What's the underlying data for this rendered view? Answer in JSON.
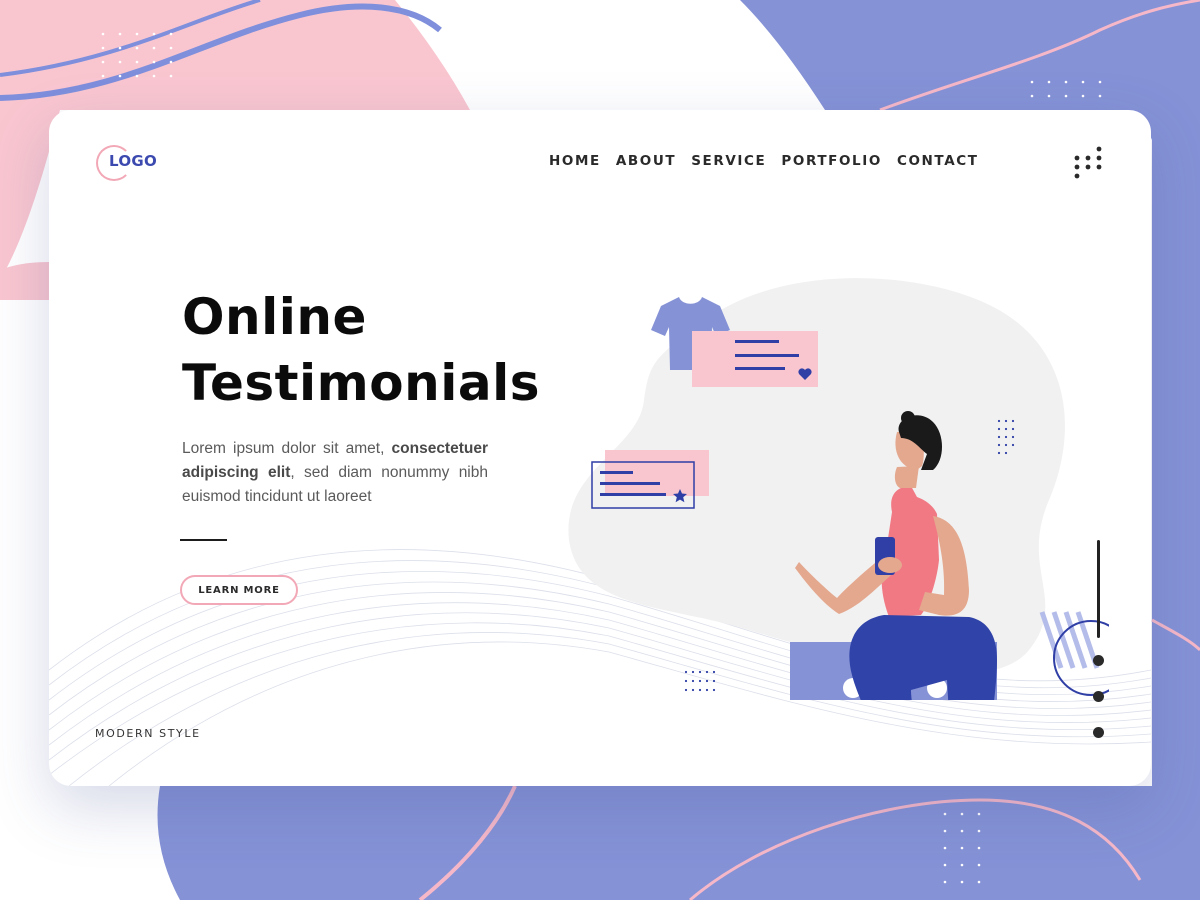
{
  "logo": {
    "text": "LOGO"
  },
  "nav": {
    "items": [
      {
        "label": "HOME"
      },
      {
        "label": "ABOUT"
      },
      {
        "label": "SERVICE"
      },
      {
        "label": "PORTFOLIO"
      },
      {
        "label": "CONTACT"
      }
    ]
  },
  "menu_icon": "grid-dots-icon",
  "hero": {
    "title_line1": "Online",
    "title_line2": "Testimonials",
    "text_part1": "Lorem ipsum dolor sit amet, ",
    "text_bold": "consectetuer adipiscing elit",
    "text_part2": ", sed diam nonummy nibh euismod tincidunt ut laoreet",
    "button_label": "LEARN MORE"
  },
  "footer": {
    "label": "MODERN STYLE"
  },
  "pager": {
    "dots": 3
  },
  "colors": {
    "pink": "#f9c6d0",
    "pink_accent": "#f2a8b6",
    "periwinkle": "#8592d6",
    "navy": "#2f3fa6",
    "text_dark": "#0b0b0b"
  }
}
